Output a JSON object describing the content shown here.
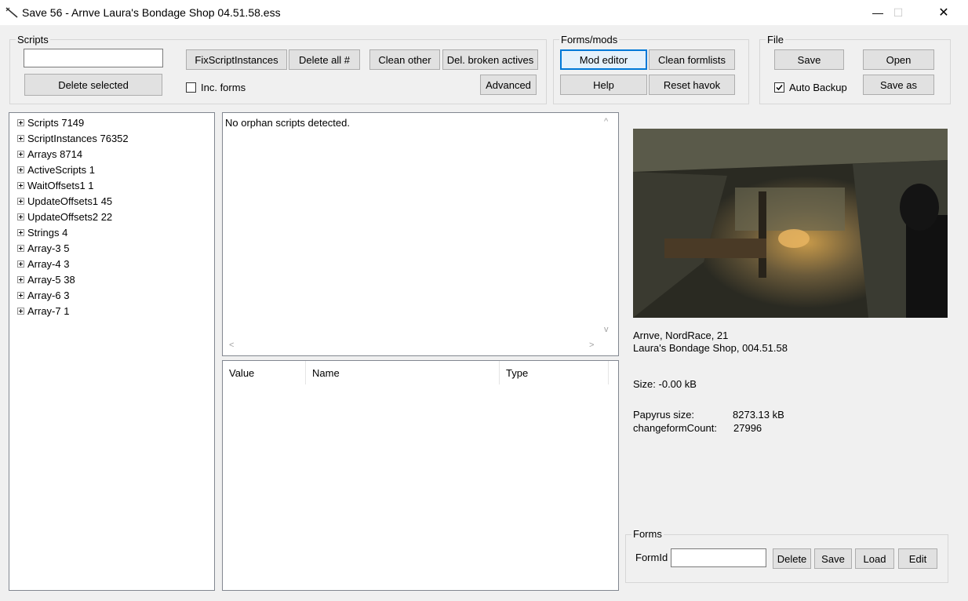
{
  "window": {
    "title": "Save 56 - Arnve  Laura's Bondage Shop  04.51.58.ess",
    "minimize": "—",
    "maximize": "☐",
    "close": "✕"
  },
  "scripts_group": {
    "label": "Scripts",
    "search_value": "",
    "delete_selected": "Delete selected",
    "fix_script_instances": "FixScriptInstances",
    "delete_all": "Delete all #",
    "clean_other": "Clean other",
    "del_broken_actives": "Del. broken actives",
    "advanced": "Advanced",
    "inc_forms_label": "Inc. forms",
    "inc_forms_checked": false
  },
  "forms_mods_group": {
    "label": "Forms/mods",
    "mod_editor": "Mod editor",
    "clean_formlists": "Clean formlists",
    "help": "Help",
    "reset_havok": "Reset havok"
  },
  "file_group": {
    "label": "File",
    "save": "Save",
    "open": "Open",
    "auto_backup_label": "Auto Backup",
    "auto_backup_checked": true,
    "save_as": "Save as"
  },
  "tree": {
    "items": [
      {
        "label": "Scripts 7149"
      },
      {
        "label": "ScriptInstances 76352"
      },
      {
        "label": "Arrays 8714"
      },
      {
        "label": "ActiveScripts 1"
      },
      {
        "label": "WaitOffsets1 1"
      },
      {
        "label": "UpdateOffsets1 45"
      },
      {
        "label": "UpdateOffsets2 22"
      },
      {
        "label": "Strings 4"
      },
      {
        "label": "Array-3 5"
      },
      {
        "label": "Array-4 3"
      },
      {
        "label": "Array-5 38"
      },
      {
        "label": "Array-6 3"
      },
      {
        "label": "Array-7 1"
      }
    ]
  },
  "message_panel": {
    "text": "No orphan scripts detected."
  },
  "table": {
    "columns": [
      "Value",
      "Name",
      "Type"
    ]
  },
  "save_info": {
    "character": "Arnve, NordRace, 21",
    "location": "Laura's Bondage Shop, 004.51.58",
    "size": "Size: -0.00 kB",
    "papyrus_label": "Papyrus size:",
    "papyrus_value": "8273.13 kB",
    "changeform_label": "changeformCount:",
    "changeform_value": "27996"
  },
  "forms_group": {
    "label": "Forms",
    "formid_label": "FormId",
    "formid_value": "",
    "delete": "Delete",
    "save": "Save",
    "load": "Load",
    "edit": "Edit"
  }
}
